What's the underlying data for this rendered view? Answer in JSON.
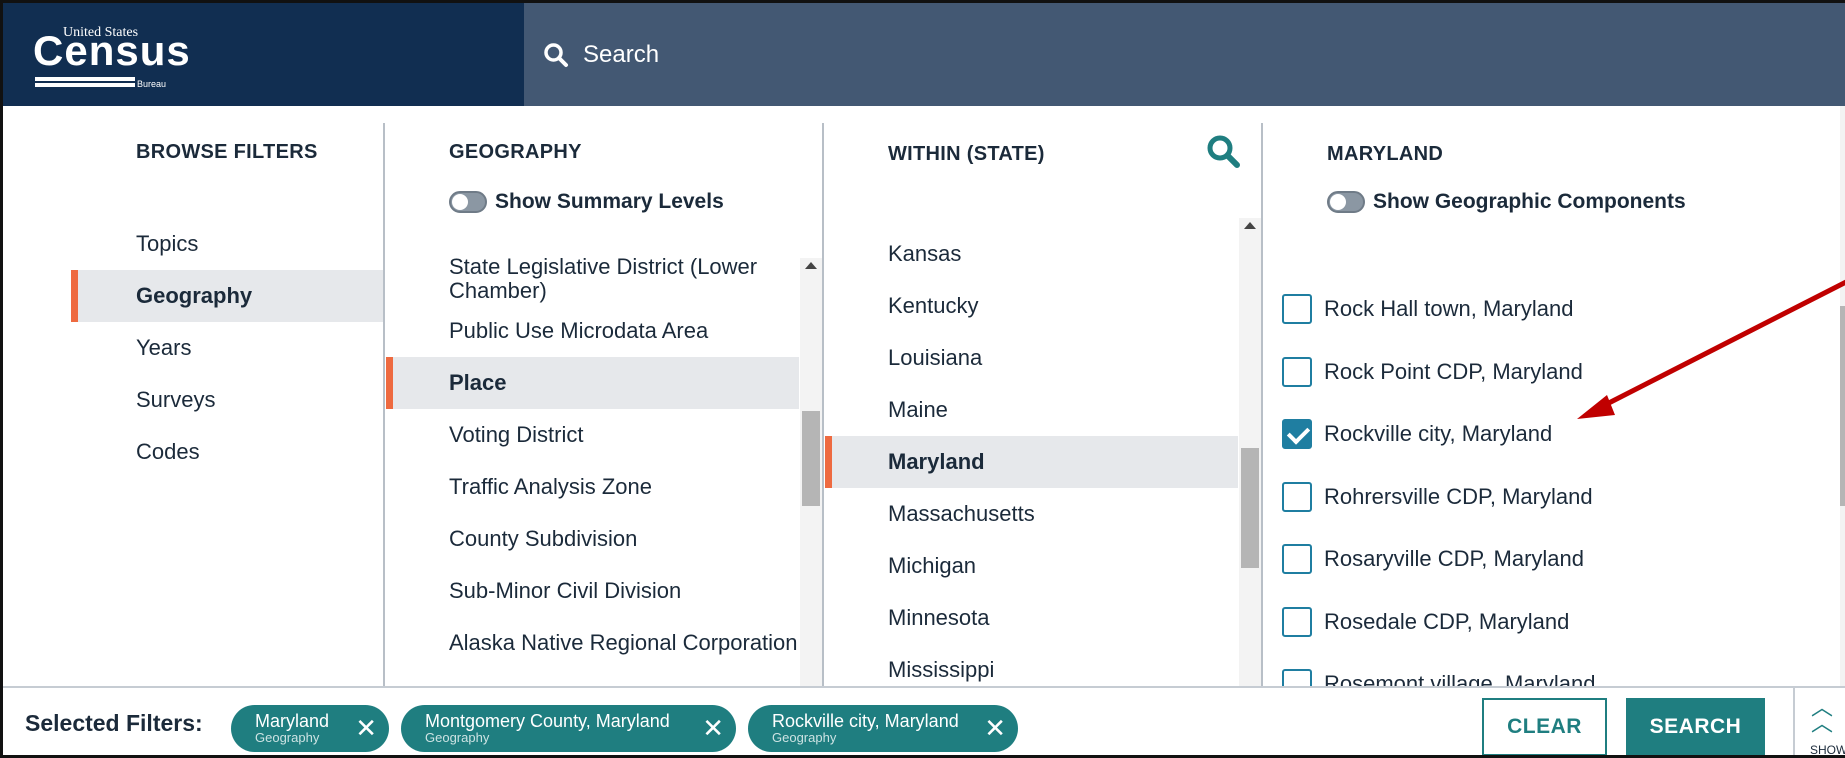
{
  "header": {
    "logo_top": "United States",
    "logo_main": "Census",
    "logo_bottom": "Bureau",
    "search_placeholder": "Search"
  },
  "browse": {
    "title": "BROWSE FILTERS",
    "items": [
      {
        "label": "Topics"
      },
      {
        "label": "Geography"
      },
      {
        "label": "Years"
      },
      {
        "label": "Surveys"
      },
      {
        "label": "Codes"
      }
    ]
  },
  "geography": {
    "title": "GEOGRAPHY",
    "toggle_label": "Show Summary Levels",
    "items": [
      {
        "label": "State Legislative District (Lower Chamber)"
      },
      {
        "label": "Public Use Microdata Area"
      },
      {
        "label": "Place"
      },
      {
        "label": "Voting District"
      },
      {
        "label": "Traffic Analysis Zone"
      },
      {
        "label": "County Subdivision"
      },
      {
        "label": "Sub-Minor Civil Division"
      },
      {
        "label": "Alaska Native Regional Corporation"
      }
    ]
  },
  "state": {
    "title": "WITHIN (STATE)",
    "items": [
      {
        "label": "Kansas"
      },
      {
        "label": "Kentucky"
      },
      {
        "label": "Louisiana"
      },
      {
        "label": "Maine"
      },
      {
        "label": "Maryland"
      },
      {
        "label": "Massachusetts"
      },
      {
        "label": "Michigan"
      },
      {
        "label": "Minnesota"
      },
      {
        "label": "Mississippi"
      }
    ]
  },
  "place": {
    "title": "MARYLAND",
    "toggle_label": "Show Geographic Components",
    "items": [
      {
        "label": "Rock Hall town, Maryland",
        "checked": false
      },
      {
        "label": "Rock Point CDP, Maryland",
        "checked": false
      },
      {
        "label": "Rockville city, Maryland",
        "checked": true
      },
      {
        "label": "Rohrersville CDP, Maryland",
        "checked": false
      },
      {
        "label": "Rosaryville CDP, Maryland",
        "checked": false
      },
      {
        "label": "Rosedale CDP, Maryland",
        "checked": false
      },
      {
        "label": "Rosemont village, Maryland",
        "checked": false
      }
    ]
  },
  "footer": {
    "selected_label": "Selected Filters:",
    "chips": [
      {
        "name": "Maryland",
        "type": "Geography"
      },
      {
        "name": "Montgomery County, Maryland",
        "type": "Geography"
      },
      {
        "name": "Rockville city, Maryland",
        "type": "Geography"
      }
    ],
    "clear_label": "CLEAR",
    "search_label": "SEARCH",
    "show_label": "SHOW"
  },
  "colors": {
    "header_dark": "#112e51",
    "header": "#435873",
    "accent_orange": "#ee6a40",
    "teal": "#1f7e80",
    "checkbox_blue": "#1f7ea1",
    "annotation_red": "#c00000"
  }
}
